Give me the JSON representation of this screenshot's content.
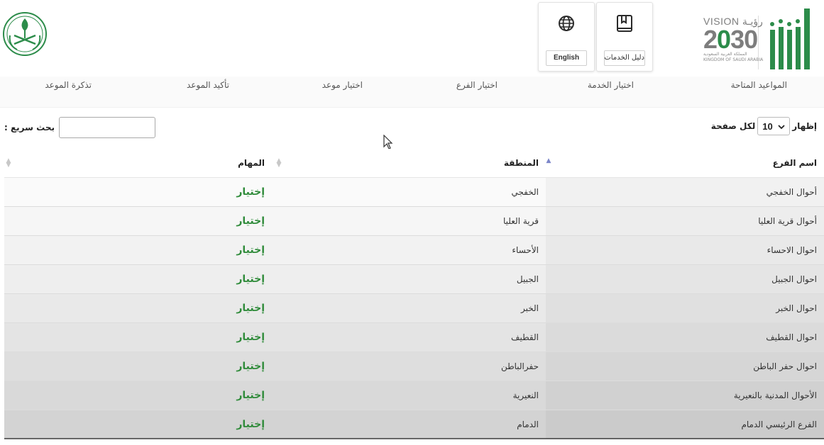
{
  "header": {
    "guide_label": "دليل الخدمات",
    "english_label": "English",
    "vision": {
      "top_en": "VISION",
      "top_ar": "رؤيـة",
      "year_a": "2",
      "year_b": "30",
      "sub_ar": "المملكة العربية السعودية",
      "sub_en": "KINGDOM OF SAUDI ARABIA"
    },
    "brand_color": "#2c8c4a"
  },
  "steps": [
    {
      "label": "المواعيد المتاحة"
    },
    {
      "label": "اختيار الخدمة"
    },
    {
      "label": "اختيار الفرع"
    },
    {
      "label": "اختيار موعد"
    },
    {
      "label": "تأكيد الموعد"
    },
    {
      "label": "تذكرة الموعد"
    }
  ],
  "controls": {
    "show_label": "إظهار",
    "per_page_value": "10",
    "per_page_label": "لكل صفحة",
    "search_label": "بحث سريع :",
    "search_value": ""
  },
  "table": {
    "headers": {
      "branch": "اسم الفرع",
      "region": "المنطقة",
      "action": "المهام"
    },
    "rows": [
      {
        "branch": "أحوال الخفجي",
        "region": "الخفجي",
        "action": "إختيار"
      },
      {
        "branch": "أحوال قرية العليا",
        "region": "قرية العليا",
        "action": "إختيار"
      },
      {
        "branch": "احوال الاحساء",
        "region": "الأحساء",
        "action": "إختيار"
      },
      {
        "branch": "احوال الجبيل",
        "region": "الجبيل",
        "action": "إختيار"
      },
      {
        "branch": "احوال الخبر",
        "region": "الخبر",
        "action": "إختيار"
      },
      {
        "branch": "احوال القطيف",
        "region": "القطيف",
        "action": "إختيار"
      },
      {
        "branch": "احوال حفر الباطن",
        "region": "حفرالباطن",
        "action": "إختيار"
      },
      {
        "branch": "الأحوال المدنية بالنعيرية",
        "region": "النعيرية",
        "action": "إختيار"
      },
      {
        "branch": "الفرع الرئيسي الدمام",
        "region": "الدمام",
        "action": "إختيار"
      }
    ],
    "action_color": "#2f8b3a"
  },
  "icons": {
    "emblem": "saudi-emblem-icon",
    "brand": "absher-logo-icon",
    "guide": "book-icon",
    "language": "globe-icon",
    "dropdown": "chevron-down-icon",
    "sort": "sort-icon",
    "cursor": "mouse-cursor-icon"
  }
}
